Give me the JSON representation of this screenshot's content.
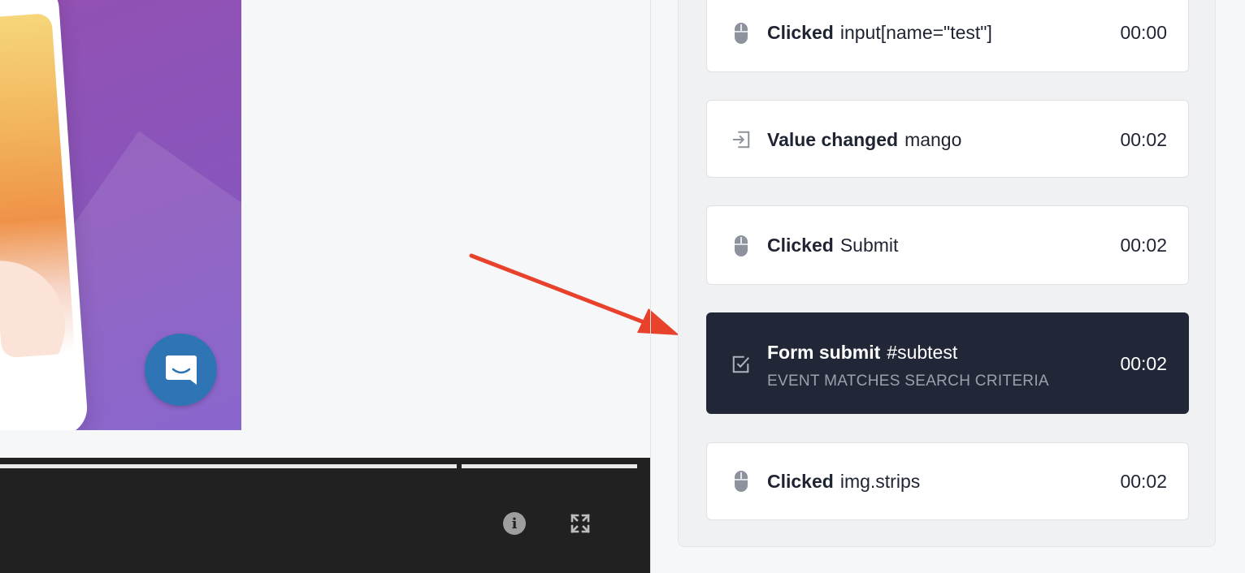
{
  "events": [
    {
      "type": "Clicked",
      "detail": "input[name=\"test\"]",
      "time": "00:00",
      "icon": "mouse-icon"
    },
    {
      "type": "Value changed",
      "detail": "mango",
      "time": "00:02",
      "icon": "input-arrow-icon"
    },
    {
      "type": "Clicked",
      "detail": "Submit",
      "time": "00:02",
      "icon": "mouse-icon"
    },
    {
      "type": "Form submit",
      "detail": "#subtest",
      "time": "00:02",
      "icon": "checkbox-icon",
      "subtitle": "EVENT MATCHES SEARCH CRITERIA",
      "active": true
    },
    {
      "type": "Clicked",
      "detail": "img.strips",
      "time": "00:02",
      "icon": "mouse-icon"
    }
  ],
  "player": {
    "info_icon": "info-icon",
    "fullscreen_icon": "fullscreen-icon",
    "chat_icon": "chat-icon"
  },
  "colors": {
    "active_event_bg": "#222738",
    "annotation_arrow": "#e8412c",
    "chat_bubble": "#2f75b5",
    "control_bar": "#212121"
  }
}
